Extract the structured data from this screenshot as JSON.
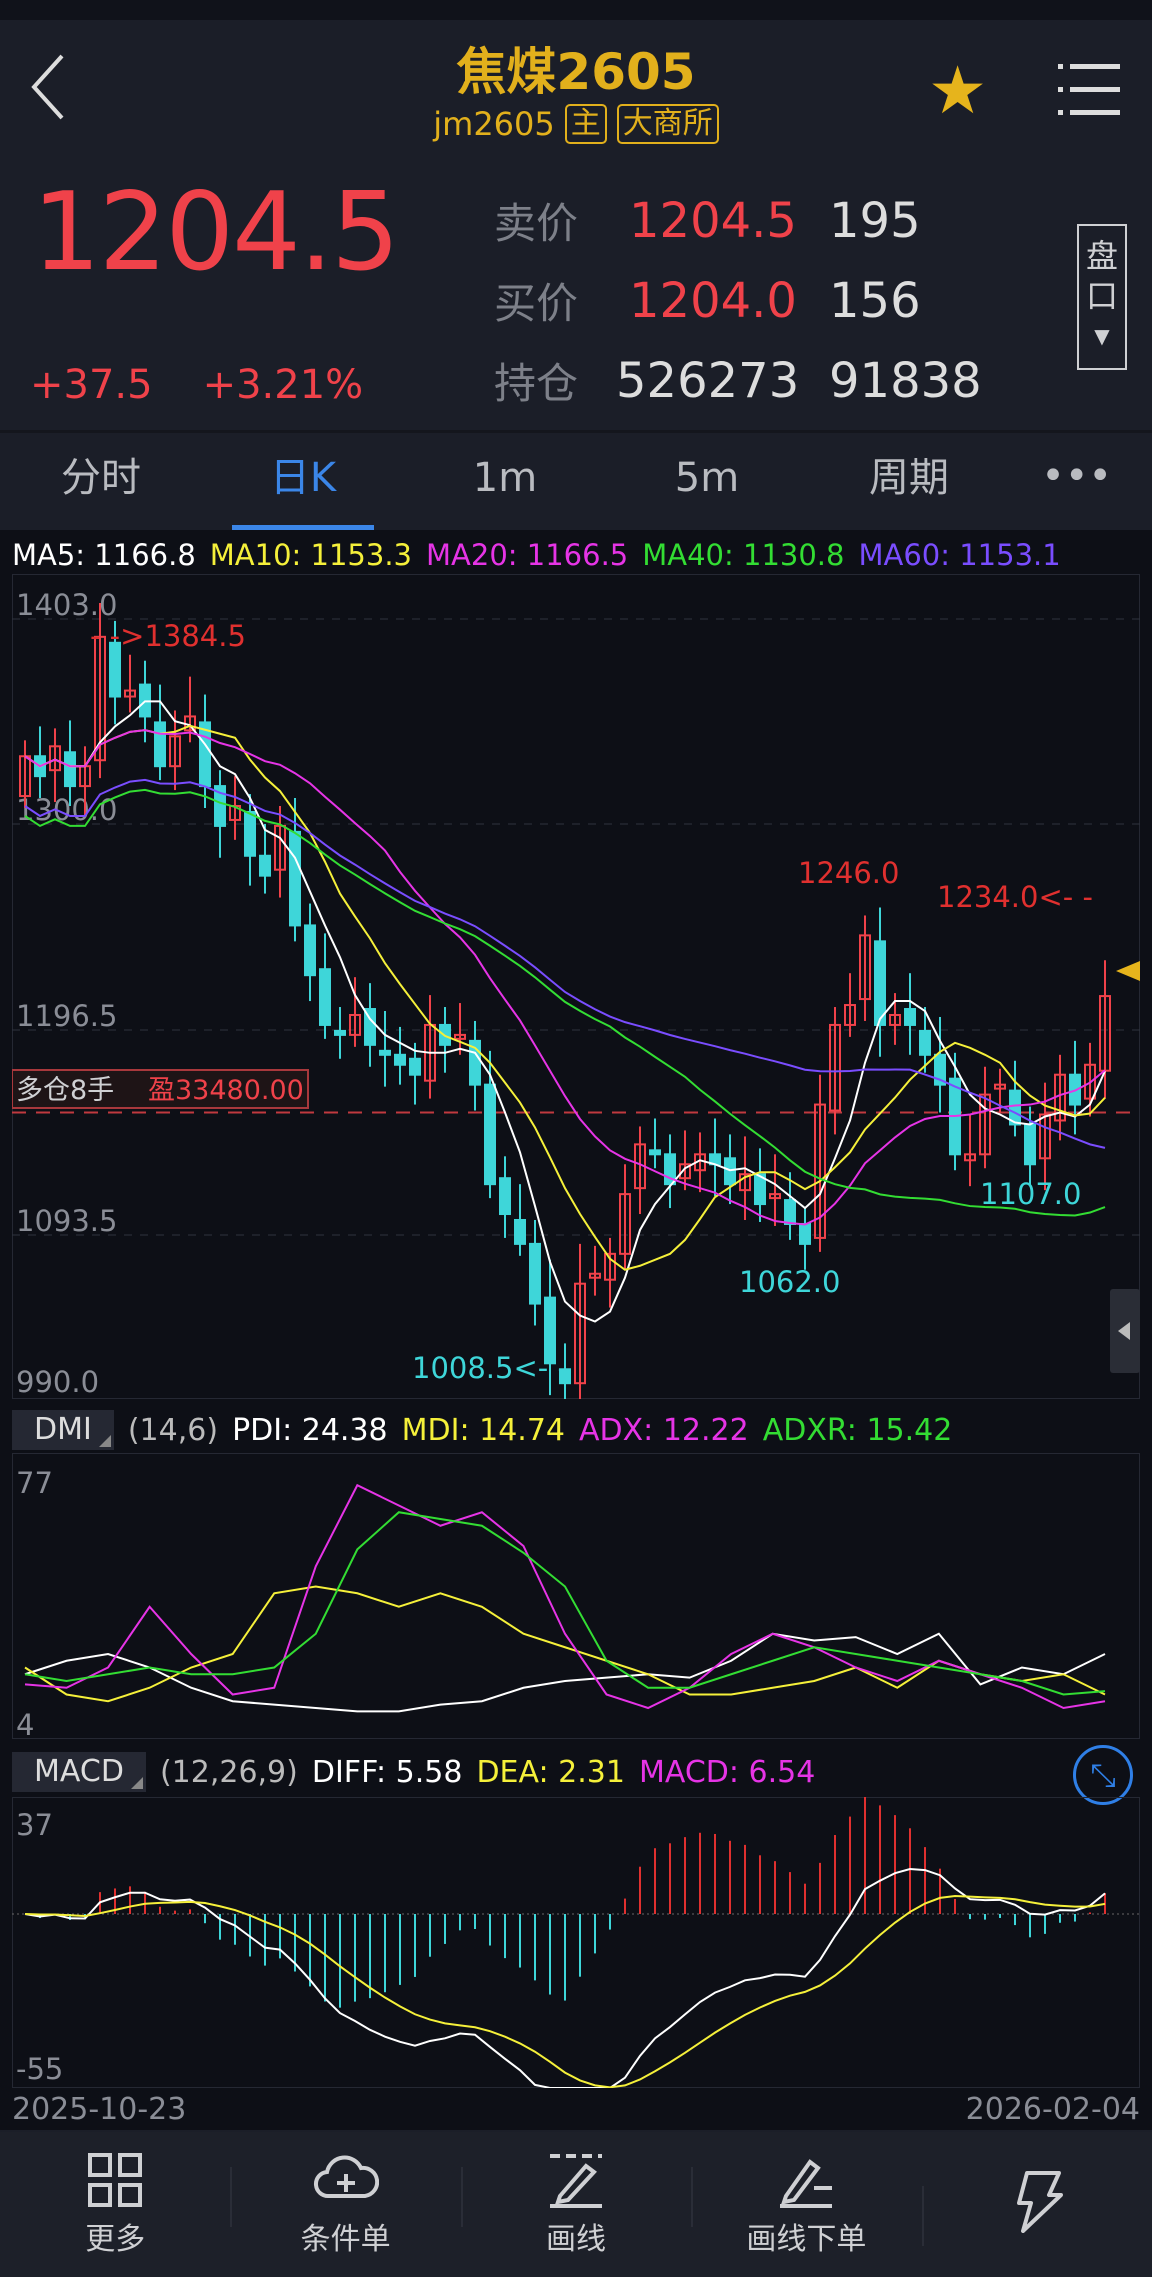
{
  "header": {
    "title": "焦煤2605",
    "code": "jm2605",
    "tag_main": "主",
    "exchange": "大商所"
  },
  "quote": {
    "price": "1204.5",
    "change": "+37.5",
    "change_pct": "+3.21%",
    "sell_label": "卖价",
    "sell_price": "1204.5",
    "sell_vol": "195",
    "buy_label": "买价",
    "buy_price": "1204.0",
    "buy_vol": "156",
    "hold_label": "持仓",
    "hold_value": "526273",
    "hold_change": "91838",
    "pankou_label1": "盘",
    "pankou_label2": "口"
  },
  "tabs": [
    {
      "label": "分时"
    },
    {
      "label": "日K",
      "active": true
    },
    {
      "label": "1m"
    },
    {
      "label": "5m"
    },
    {
      "label": "周期"
    }
  ],
  "tabs_more": "•••",
  "ma_legend": [
    {
      "text": "MA5: 1166.8",
      "color": "#ffffff"
    },
    {
      "text": "MA10: 1153.3",
      "color": "#f5f03a"
    },
    {
      "text": "MA20: 1166.5",
      "color": "#e634e6"
    },
    {
      "text": "MA40: 1130.8",
      "color": "#33dd33"
    },
    {
      "text": "MA60: 1153.1",
      "color": "#7a4dff"
    }
  ],
  "kline": {
    "axis_labels": [
      "1403.0",
      "1300.0",
      "1196.5",
      "1093.5",
      "990.0"
    ],
    "axis_values": [
      1403,
      1300,
      1196.5,
      1093.5,
      990
    ],
    "closes": [
      1325,
      1315,
      1330,
      1310,
      1320,
      1385,
      1355,
      1358,
      1345,
      1320,
      1335,
      1345,
      1310,
      1290,
      1300,
      1275,
      1265,
      1290,
      1240,
      1215,
      1190,
      1185,
      1195,
      1180,
      1175,
      1170,
      1165,
      1190,
      1180,
      1185,
      1160,
      1110,
      1095,
      1080,
      1050,
      1020,
      1010,
      1060,
      1065,
      1075,
      1105,
      1130,
      1125,
      1110,
      1120,
      1125,
      1120,
      1110,
      1115,
      1100,
      1105,
      1090,
      1080,
      1150,
      1190,
      1200,
      1235,
      1190,
      1195,
      1190,
      1175,
      1160,
      1125,
      1125,
      1155,
      1160,
      1140,
      1120,
      1145,
      1165,
      1150,
      1170,
      1204.5
    ],
    "annotations": {
      "high": "- ->1384.5",
      "peak2": "1246.0",
      "recent_high": "1234.0<- -",
      "low": "1008.5<- -",
      "low2": "1062.0",
      "low3": "1107.0"
    },
    "position": {
      "label": "多仓8手",
      "profit": "盈33480.00",
      "price": 1146
    }
  },
  "dmi": {
    "name": "DMI",
    "params": "(14,6)",
    "pdi": "PDI: 24.38",
    "mdi": "MDI: 14.74",
    "adx": "ADX: 12.22",
    "adxr": "ADXR: 15.42",
    "ymax": "77",
    "ymin": "4",
    "series": {
      "pdi": [
        18,
        22,
        24,
        20,
        14,
        10,
        9,
        8,
        7,
        7,
        9,
        10,
        14,
        16,
        17,
        18,
        17,
        22,
        30,
        28,
        29,
        24,
        30,
        15,
        20,
        18,
        24
      ],
      "mdi": [
        20,
        12,
        10,
        14,
        20,
        24,
        42,
        44,
        42,
        38,
        42,
        38,
        30,
        26,
        22,
        18,
        12,
        12,
        14,
        16,
        20,
        14,
        22,
        18,
        16,
        18,
        12
      ],
      "adx": [
        15,
        14,
        20,
        38,
        24,
        12,
        14,
        50,
        74,
        68,
        62,
        66,
        56,
        30,
        12,
        8,
        14,
        24,
        30,
        26,
        20,
        16,
        22,
        18,
        14,
        8,
        10
      ],
      "adxr": [
        18,
        16,
        18,
        20,
        18,
        18,
        20,
        30,
        55,
        66,
        64,
        62,
        54,
        44,
        22,
        14,
        14,
        18,
        22,
        26,
        24,
        22,
        20,
        18,
        16,
        12,
        13
      ]
    },
    "colors": {
      "pdi": "#ffffff",
      "mdi": "#f5f03a",
      "adx": "#e634e6",
      "adxr": "#33dd33"
    }
  },
  "macd": {
    "name": "MACD",
    "params": "(12,26,9)",
    "diff": "DIFF: 5.58",
    "dea": "DEA: 2.31",
    "macd": "MACD: 6.54",
    "ymax": "37",
    "ymin": "-55"
  },
  "dates": {
    "start": "2025-10-23",
    "end": "2026-02-04"
  },
  "nav": [
    {
      "label": "更多",
      "icon": "grid-icon"
    },
    {
      "label": "条件单",
      "icon": "cloud-plus-icon"
    },
    {
      "label": "画线",
      "icon": "pen-line-icon"
    },
    {
      "label": "画线下单",
      "icon": "pen-order-icon"
    },
    {
      "label": "",
      "icon": "lightning-icon"
    }
  ],
  "colors": {
    "up": "#f0424a",
    "down": "#3ed6d9",
    "gold": "#e2b01c"
  }
}
